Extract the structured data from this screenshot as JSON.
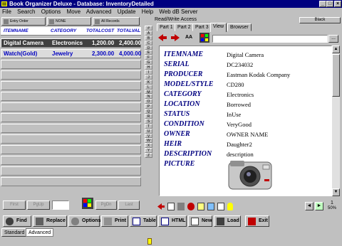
{
  "window": {
    "title": "Book Organizer Deluxe - Database: InventoryDetailed"
  },
  "menu": [
    "File",
    "Search",
    "Options",
    "Move",
    "Advanced",
    "Update",
    "Help",
    "Web dB Server"
  ],
  "left_toolbar": {
    "entry_order": "Entry Order",
    "none": "NONE",
    "all_records": "All Records"
  },
  "columns": [
    "ITEMNAME",
    "CATEGORY",
    "TOTALCOST",
    "TOTALVAL"
  ],
  "rows": [
    {
      "name": "Digital Camera",
      "category": "Electronics",
      "cost": "1,200.00",
      "val": "2,400.00",
      "selected": true
    },
    {
      "name": "Watch(Gold)",
      "category": "Jewelry",
      "cost": "2,300.00",
      "val": "4,000.00",
      "selected": false
    }
  ],
  "left_nav": {
    "first": "First",
    "pgup": "PgUp",
    "pgdn": "PgDn",
    "last": "Last"
  },
  "alpha": [
    "#",
    "A",
    "B",
    "C",
    "D",
    "E",
    "F",
    "G",
    "H",
    "I",
    "J",
    "K",
    "L",
    "M",
    "N",
    "O",
    "P",
    "Q",
    "R",
    "S",
    "T",
    "U",
    "V",
    "W",
    "X",
    "Y",
    "Z"
  ],
  "right": {
    "readwrite": "Read/Write Access",
    "black": "Black",
    "tabs": [
      "Part 1",
      "Part 2",
      "Part 3",
      "View",
      "Browser"
    ],
    "active_tab": "View",
    "search_btn": "..."
  },
  "fields": [
    {
      "label": "ITEMNAME",
      "value": "Digital Camera"
    },
    {
      "label": "SERIAL",
      "value": "DC234032"
    },
    {
      "label": "PRODUCER",
      "value": "Eastman Kodak Company"
    },
    {
      "label": "MODEL/STYLE",
      "value": "CD280"
    },
    {
      "label": "CATEGORY",
      "value": "Electronics"
    },
    {
      "label": "LOCATION",
      "value": "Borrowed"
    },
    {
      "label": "STATUS",
      "value": "InUse"
    },
    {
      "label": "CONDITION",
      "value": "VeryGood"
    },
    {
      "label": "OWNER",
      "value": "OWNER NAME"
    },
    {
      "label": "HEIR",
      "value": "Daughter2"
    },
    {
      "label": "DESCRIPTION",
      "value": "description"
    },
    {
      "label": "PICTURE",
      "value": ""
    }
  ],
  "zoom": {
    "num": "1",
    "pct": "50%"
  },
  "bottom_buttons": [
    "Find",
    "Replace",
    "Options",
    "Print",
    "Table",
    "HTML",
    "New",
    "Load",
    "Exit"
  ],
  "bottom_tabs": [
    "Standard",
    "Advanced"
  ],
  "colors": {
    "title": "#000080",
    "label": "#000080",
    "selected_row": "#404040"
  }
}
